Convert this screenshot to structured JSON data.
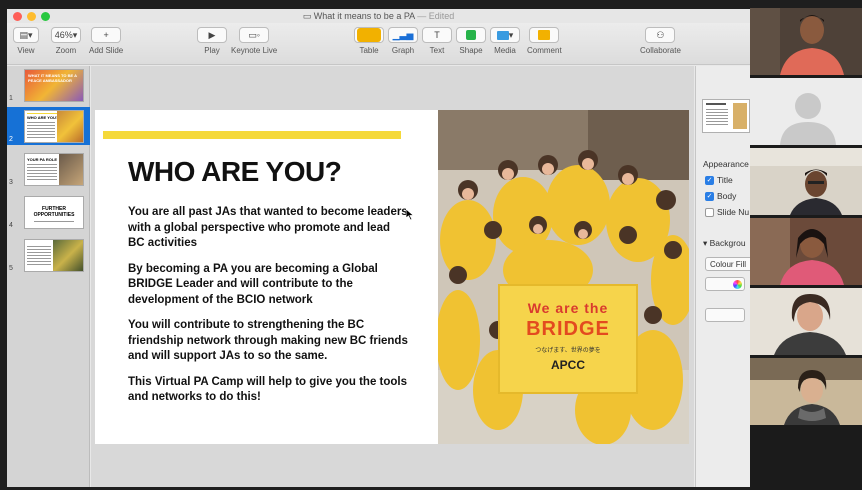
{
  "window": {
    "title": "What it means to be a PA",
    "status": "— Edited"
  },
  "toolbar": {
    "view": "View",
    "zoom_value": "46%",
    "zoom": "Zoom",
    "add_slide": "Add Slide",
    "play": "Play",
    "keynote_live": "Keynote Live",
    "table": "Table",
    "graph": "Graph",
    "text": "Text",
    "shape": "Shape",
    "media": "Media",
    "comment": "Comment",
    "collaborate": "Collaborate"
  },
  "navigator": {
    "slides": [
      {
        "num": "1",
        "heading": "WHAT IT MEANS TO BE A PEACE AMBASSADOR"
      },
      {
        "num": "2",
        "heading": "WHO ARE YOU?"
      },
      {
        "num": "3",
        "heading": "YOUR PA ROLE"
      },
      {
        "num": "4",
        "heading": "FURTHER OPPORTUNITIES"
      },
      {
        "num": "5",
        "heading": ""
      }
    ]
  },
  "slide": {
    "title": "WHO ARE YOU?",
    "paragraphs": [
      "You are all past JAs that wanted to become leaders with a global perspective who promote and lead BC activities",
      "By becoming a PA you are becoming a Global BRIDGE Leader and will contribute to the development of the BCIO network",
      "You will contribute to strengthening the BC friendship network through making new BC friends and will support JAs to so the same.",
      "This Virtual PA Camp will help to give you the tools and networks to do this!"
    ],
    "banner": {
      "line1": "We are the",
      "line2": "BRIDGE",
      "line3": "つなげます、世界の夢を",
      "line4": "APCC"
    }
  },
  "inspector": {
    "appearance": "Appearance",
    "title_opt": "Title",
    "body_opt": "Body",
    "slide_number": "Slide Nu",
    "background": "Backgrou",
    "fill": "Colour Fill"
  },
  "colors": {
    "accent_blue": "#1671d6",
    "title_yellow": "#f5d93a",
    "insert_orange": "#f2b100",
    "traffic_red": "#fe5f57",
    "traffic_yellow": "#febc2e",
    "traffic_green": "#28c840"
  }
}
